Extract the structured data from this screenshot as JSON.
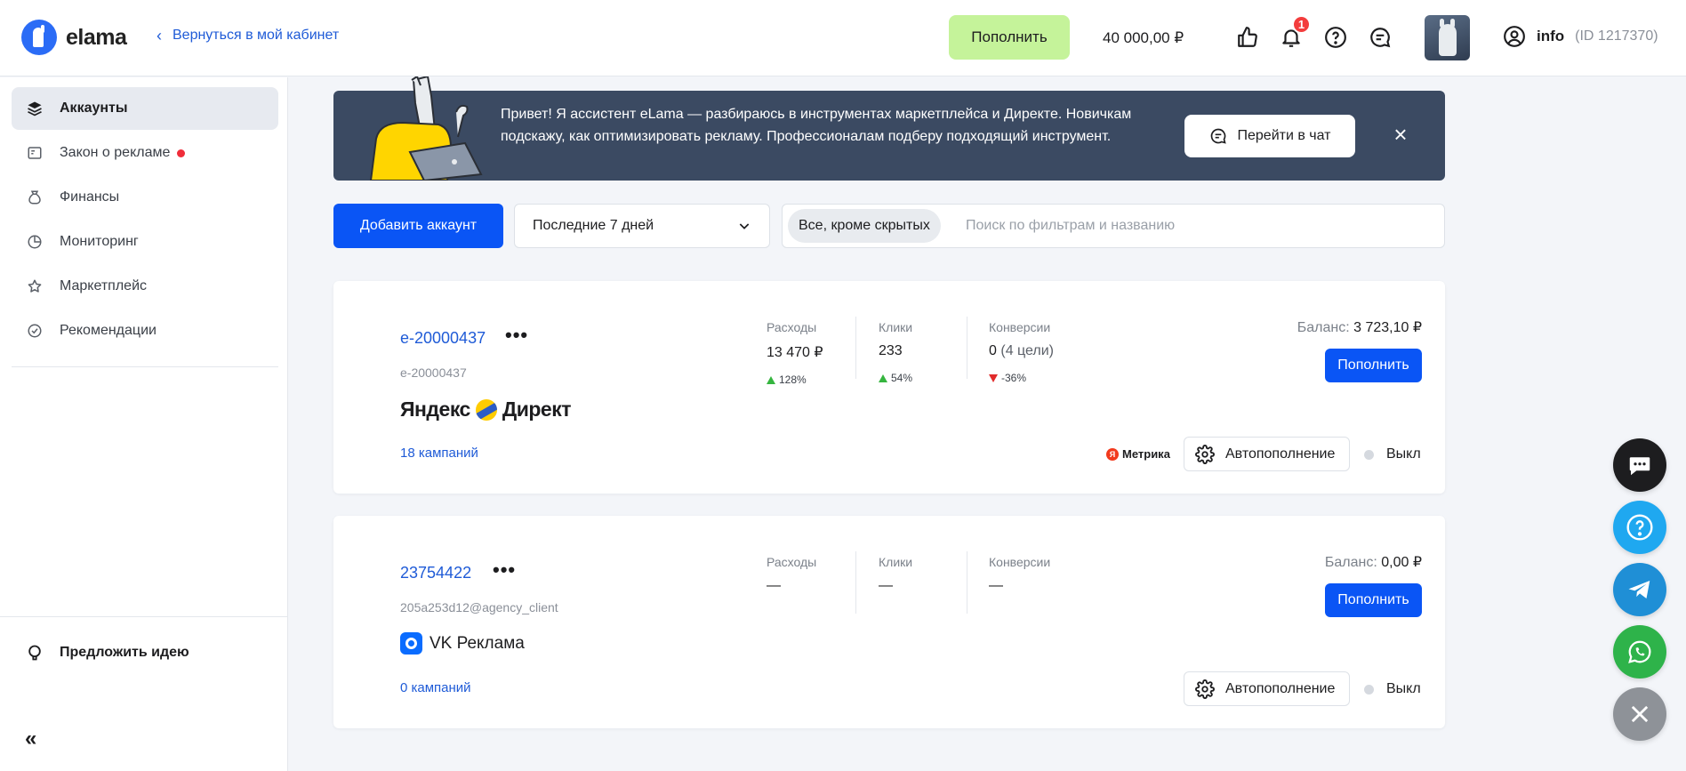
{
  "header": {
    "logo_text": "elama",
    "back_link": "Вернуться в мой кабинет",
    "topup_button": "Пополнить",
    "balance": "40 000,00 ₽",
    "notifications_count": "1",
    "user_name": "info",
    "user_id": "(ID 1217370)"
  },
  "sidebar": {
    "items": [
      {
        "label": "Аккаунты",
        "icon": "layers-icon",
        "active": true
      },
      {
        "label": "Закон о рекламе",
        "icon": "document-icon",
        "badge": "red-dot"
      },
      {
        "label": "Финансы",
        "icon": "money-bag-icon"
      },
      {
        "label": "Мониторинг",
        "icon": "chart-pie-icon"
      },
      {
        "label": "Маркетплейс",
        "icon": "star-icon"
      },
      {
        "label": "Рекомендации",
        "icon": "check-circle-icon"
      }
    ],
    "idea": "Предложить идею",
    "collapse": "«"
  },
  "banner": {
    "text": "Привет! Я ассистент eLama — разбираюсь в инструментах маркетплейса и Директе. Новичкам подскажу, как оптимизировать рекламу. Профессионалам подберу подходящий инструмент.",
    "button": "Перейти в чат",
    "close": "×"
  },
  "toolbar": {
    "add_account": "Добавить аккаунт",
    "period": "Последние 7 дней",
    "filter_chip": "Все, кроме скрытых",
    "search_placeholder": "Поиск по фильтрам и названию"
  },
  "accounts": [
    {
      "title": "e-20000437",
      "subtitle": "e-20000437",
      "platform": "Директ",
      "platform_prefix": "Яндекс",
      "campaigns": "18 кампаний",
      "metrics": {
        "spend_label": "Расходы",
        "spend": "13 470 ₽",
        "spend_delta": "128%",
        "clicks_label": "Клики",
        "clicks": "233",
        "clicks_delta": "54%",
        "conv_label": "Конверсии",
        "conv": "0",
        "conv_goals": "(4 цели)",
        "conv_delta": "-36%"
      },
      "balance_label": "Баланс:",
      "balance": "3 723,10 ₽",
      "topup": "Пополнить",
      "metrika": "Метрика",
      "autotopup": "Автопополнение",
      "toggle": "Выкл"
    },
    {
      "title": "23754422",
      "subtitle": "205a253d12@agency_client",
      "platform": "VK Реклама",
      "campaigns": "0 кампаний",
      "metrics": {
        "spend_label": "Расходы",
        "spend": "—",
        "clicks_label": "Клики",
        "clicks": "—",
        "conv_label": "Конверсии",
        "conv": "—"
      },
      "balance_label": "Баланс:",
      "balance": "0,00 ₽",
      "topup": "Пополнить",
      "autotopup": "Автопополнение",
      "toggle": "Выкл"
    }
  ],
  "fabs": [
    {
      "icon": "chat-bubble-icon",
      "color": "#1d1d1f"
    },
    {
      "icon": "help-icon",
      "color": "#1fa8f0"
    },
    {
      "icon": "telegram-icon",
      "color": "#1f8fd6"
    },
    {
      "icon": "whatsapp-icon",
      "color": "#2eb34a"
    },
    {
      "icon": "close-icon",
      "color": "#8e9298"
    }
  ]
}
